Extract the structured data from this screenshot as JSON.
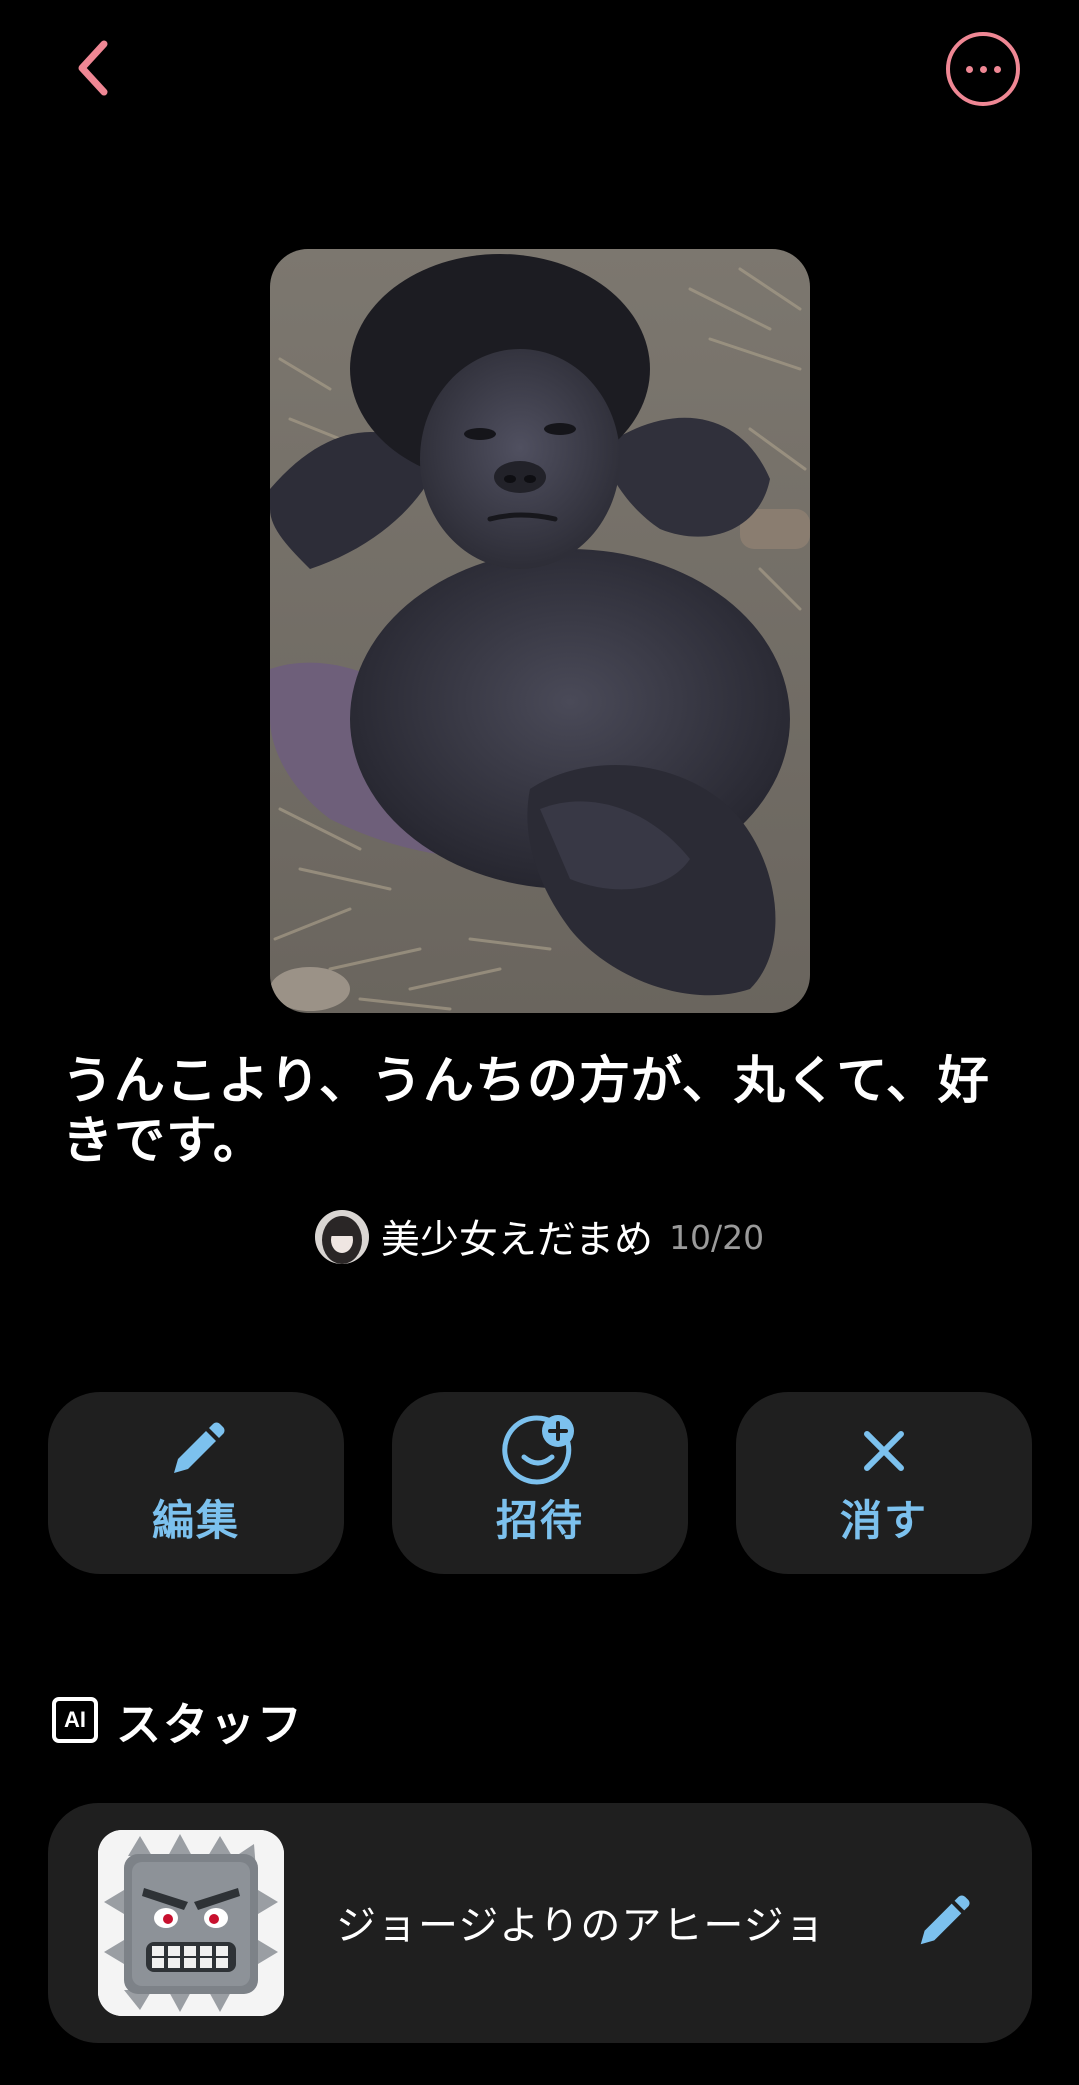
{
  "header": {
    "back_icon": "chevron-left-icon",
    "more_icon": "more-horizontal-icon",
    "accent_color": "#ef8794"
  },
  "post": {
    "title": "うんこより、うんちの方が、丸くて、好きです。",
    "author_name": "美少女えだまめ",
    "count": "10/20"
  },
  "actions": {
    "edit_label": "編集",
    "edit_icon": "pencil-icon",
    "invite_label": "招待",
    "invite_icon": "add-person-icon",
    "delete_label": "消す",
    "delete_icon": "close-icon",
    "accent_color": "#7cc1ee"
  },
  "staff": {
    "badge": "AI",
    "section_title": "スタッフ",
    "items": [
      {
        "name": "ジョージよりのアヒージョ",
        "edit_icon": "pencil-icon"
      }
    ]
  }
}
